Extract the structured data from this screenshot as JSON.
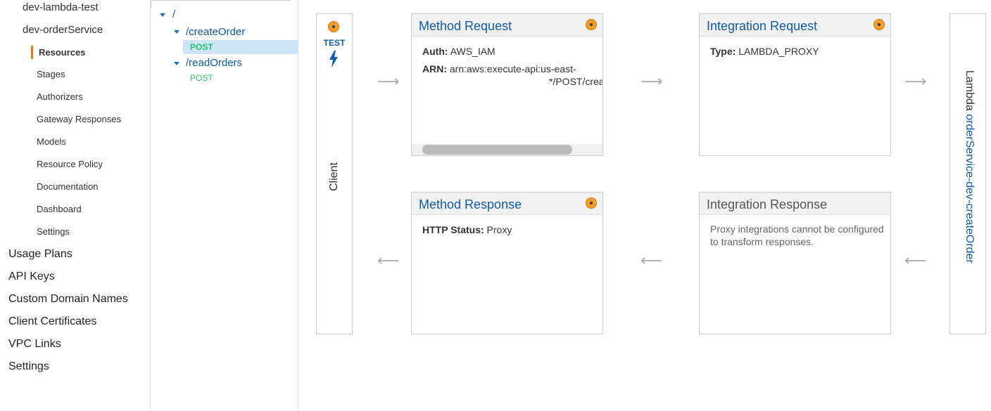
{
  "left_nav": {
    "apis": [
      "dev-lambda-test",
      "dev-orderService"
    ],
    "sub_items": [
      "Resources",
      "Stages",
      "Authorizers",
      "Gateway Responses",
      "Models",
      "Resource Policy",
      "Documentation",
      "Dashboard",
      "Settings"
    ],
    "active_item": "Resources",
    "top_items": [
      "Usage Plans",
      "API Keys",
      "Custom Domain Names",
      "Client Certificates",
      "VPC Links",
      "Settings"
    ]
  },
  "tree": {
    "root": "/",
    "resources": [
      {
        "path": "/createOrder",
        "method": "POST",
        "selected": true
      },
      {
        "path": "/readOrders",
        "method": "POST",
        "selected": false
      }
    ]
  },
  "client": {
    "test_label": "TEST",
    "label": "Client"
  },
  "method_request": {
    "title": "Method Request",
    "auth_label": "Auth:",
    "auth_value": "AWS_IAM",
    "arn_label": "ARN:",
    "arn_line1": "arn:aws:execute-api:us-east-",
    "arn_line2": "*/POST/crea"
  },
  "integration_request": {
    "title": "Integration Request",
    "type_label": "Type:",
    "type_value": "LAMBDA_PROXY"
  },
  "method_response": {
    "title": "Method Response",
    "status_label": "HTTP Status:",
    "status_value": "Proxy"
  },
  "integration_response": {
    "title": "Integration Response",
    "note": "Proxy integrations cannot be configured to transform responses."
  },
  "lambda": {
    "prefix": "Lambda",
    "function_name": "orderService-dev-createOrder"
  },
  "colors": {
    "accent": "#e47911",
    "link": "#0f5ba7",
    "method_green": "#2ec26b",
    "selected_bg": "#cce6f8"
  }
}
